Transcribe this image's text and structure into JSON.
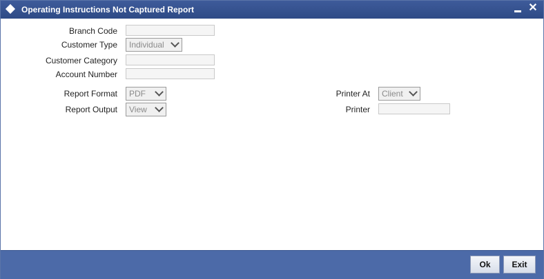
{
  "window": {
    "title": "Operating Instructions Not Captured Report",
    "minimize_symbol": "▁",
    "close_symbol": "✕"
  },
  "form": {
    "branch_code": {
      "label": "Branch Code",
      "value": ""
    },
    "customer_type": {
      "label": "Customer Type",
      "value": "Individual"
    },
    "customer_category": {
      "label": "Customer Category",
      "value": ""
    },
    "account_number": {
      "label": "Account Number",
      "value": ""
    },
    "report_format": {
      "label": "Report Format",
      "value": "PDF"
    },
    "report_output": {
      "label": "Report Output",
      "value": "View"
    },
    "printer_at": {
      "label": "Printer At",
      "value": "Client"
    },
    "printer": {
      "label": "Printer",
      "value": ""
    }
  },
  "footer": {
    "ok_label": "Ok",
    "exit_label": "Exit"
  },
  "colors": {
    "titlebar": "#2e4a86",
    "footer": "#4c6aa8"
  }
}
